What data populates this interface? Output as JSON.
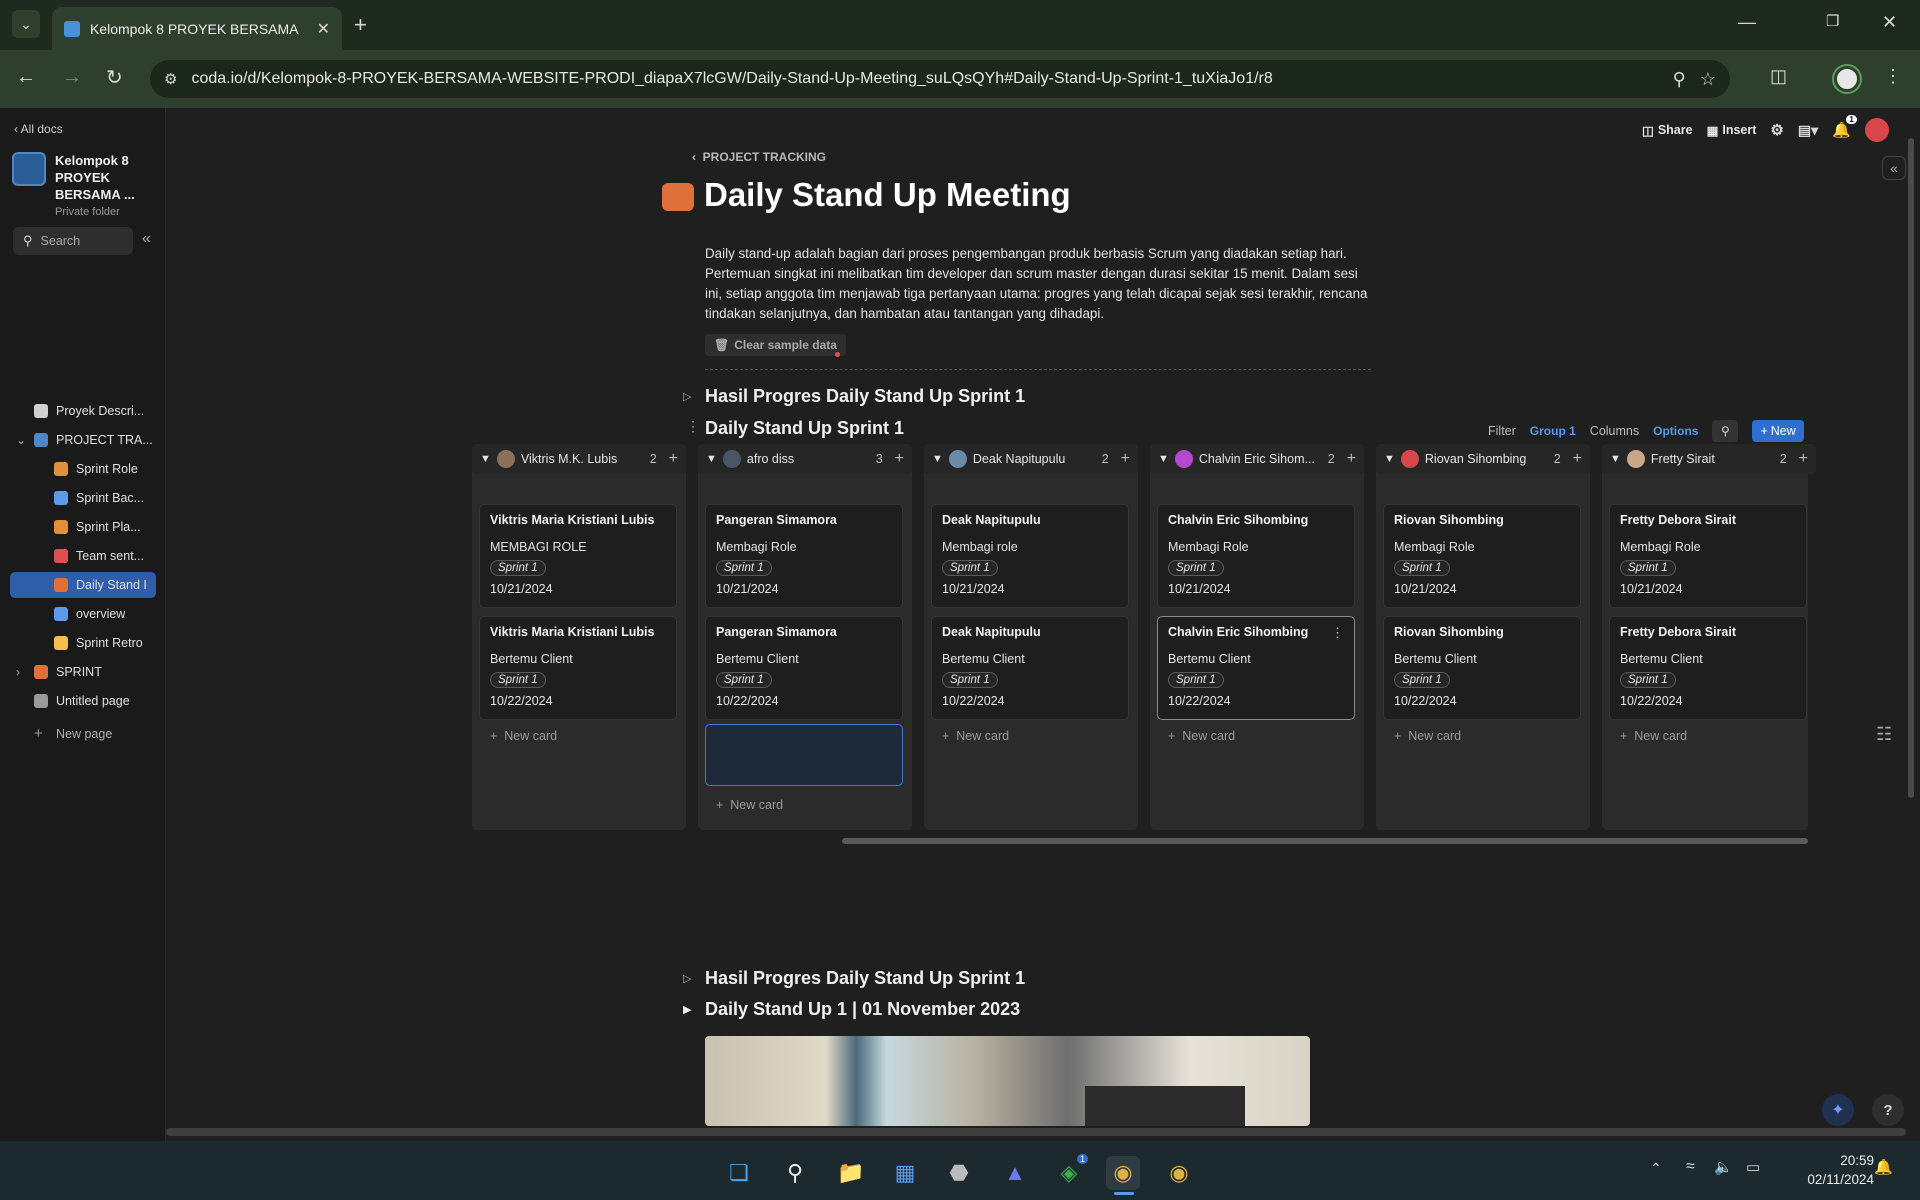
{
  "browser": {
    "tab_title": "Kelompok 8 PROYEK BERSAMA",
    "url": "coda.io/d/Kelompok-8-PROYEK-BERSAMA-WEBSITE-PRODI_diapaX7lcGW/Daily-Stand-Up-Meeting_suLQsQYh#Daily-Stand-Up-Sprint-1_tuXiaJo1/r8"
  },
  "sidebar": {
    "all_docs": "All docs",
    "doc_title": "Kelompok 8 PROYEK BERSAMA ...",
    "doc_sub": "Private folder",
    "search_placeholder": "Search",
    "items": [
      {
        "label": "Proyek Descri...",
        "icon": "clipboard-icon"
      },
      {
        "label": "PROJECT TRA...",
        "icon": "chart-icon"
      },
      {
        "label": "Sprint Role",
        "icon": "team-icon"
      },
      {
        "label": "Sprint Bac...",
        "icon": "list-icon"
      },
      {
        "label": "Sprint Pla...",
        "icon": "people-icon"
      },
      {
        "label": "Team sent...",
        "icon": "heart-icon"
      },
      {
        "label": "Daily Stand I",
        "icon": "shield-icon"
      },
      {
        "label": "overview",
        "icon": "calendar-icon"
      },
      {
        "label": "Sprint Retro",
        "icon": "bulb-icon"
      },
      {
        "label": "SPRINT",
        "icon": "runner-icon"
      },
      {
        "label": "Untitled page",
        "icon": "page-icon"
      },
      {
        "label": "New page",
        "icon": "plus-icon"
      }
    ]
  },
  "topbar": {
    "share": "Share",
    "insert": "Insert",
    "notif_count": "1"
  },
  "page": {
    "breadcrumb": "PROJECT TRACKING",
    "title": "Daily Stand Up Meeting",
    "description": "Daily stand-up adalah bagian dari proses pengembangan produk berbasis Scrum yang diadakan setiap hari. Pertemuan singkat ini melibatkan tim developer dan scrum master dengan durasi sekitar 15 menit. Dalam sesi ini, setiap anggota tim menjawab tiga pertanyaan utama: progres yang telah dicapai sejak sesi terakhir, rencana tindakan selanjutnya, dan hambatan atau tantangan yang dihadapi.",
    "clear_sample": "Clear sample data",
    "section1": "Hasil Progres Daily Stand Up Sprint 1",
    "board_title": "Daily Stand Up Sprint 1",
    "board_controls": {
      "filter": "Filter",
      "group": "Group 1",
      "columns": "Columns",
      "options": "Options",
      "new": "New"
    },
    "section2": "Hasil Progres Daily Stand Up Sprint 1",
    "section3": "Daily Stand Up 1 | 01 November 2023"
  },
  "board": {
    "new_card": "New card",
    "columns": [
      {
        "name": "Viktris M.K. Lubis",
        "count": "2",
        "avatar": "#8a6f5a",
        "cards": [
          {
            "title": "Viktris Maria Kristiani Lubis",
            "role": "MEMBAGI ROLE",
            "sprint": "Sprint 1",
            "date": "10/21/2024"
          },
          {
            "title": "Viktris Maria Kristiani Lubis",
            "role": "Bertemu Client",
            "sprint": "Sprint 1",
            "date": "10/22/2024"
          }
        ]
      },
      {
        "name": "afro diss",
        "count": "3",
        "avatar": "#4a5566",
        "cards": [
          {
            "title": "Pangeran Simamora",
            "role": "Membagi Role",
            "sprint": "Sprint 1",
            "date": "10/21/2024"
          },
          {
            "title": "Pangeran Simamora",
            "role": "Bertemu Client",
            "sprint": "Sprint 1",
            "date": "10/22/2024"
          }
        ]
      },
      {
        "name": "Deak Napitupulu",
        "count": "2",
        "avatar": "#6b8aa8",
        "cards": [
          {
            "title": "Deak Napitupulu",
            "role": "Membagi role",
            "sprint": "Sprint 1",
            "date": "10/21/2024"
          },
          {
            "title": "Deak Napitupulu",
            "role": "Bertemu Client",
            "sprint": "Sprint 1",
            "date": "10/22/2024"
          }
        ]
      },
      {
        "name": "Chalvin Eric Sihom...",
        "count": "2",
        "avatar": "#b54ad0",
        "cards": [
          {
            "title": "Chalvin Eric Sihombing",
            "role": "Membagi Role",
            "sprint": "Sprint 1",
            "date": "10/21/2024"
          },
          {
            "title": "Chalvin Eric Sihombing",
            "role": "Bertemu Client",
            "sprint": "Sprint 1",
            "date": "10/22/2024"
          }
        ]
      },
      {
        "name": "Riovan Sihombing",
        "count": "2",
        "avatar": "#d9464a",
        "cards": [
          {
            "title": "Riovan Sihombing",
            "role": "Membagi Role",
            "sprint": "Sprint 1",
            "date": "10/21/2024"
          },
          {
            "title": "Riovan Sihombing",
            "role": "Bertemu Client",
            "sprint": "Sprint 1",
            "date": "10/22/2024"
          }
        ]
      },
      {
        "name": "Fretty Sirait",
        "count": "2",
        "avatar": "#c9a68a",
        "cards": [
          {
            "title": "Fretty Debora Sirait",
            "role": "Membagi Role",
            "sprint": "Sprint 1",
            "date": "10/21/2024"
          },
          {
            "title": "Fretty Debora Sirait",
            "role": "Bertemu Client",
            "sprint": "Sprint 1",
            "date": "10/22/2024"
          }
        ]
      }
    ]
  },
  "taskbar": {
    "time": "20:59",
    "date": "02/11/2024",
    "xbox_badge": "1"
  }
}
